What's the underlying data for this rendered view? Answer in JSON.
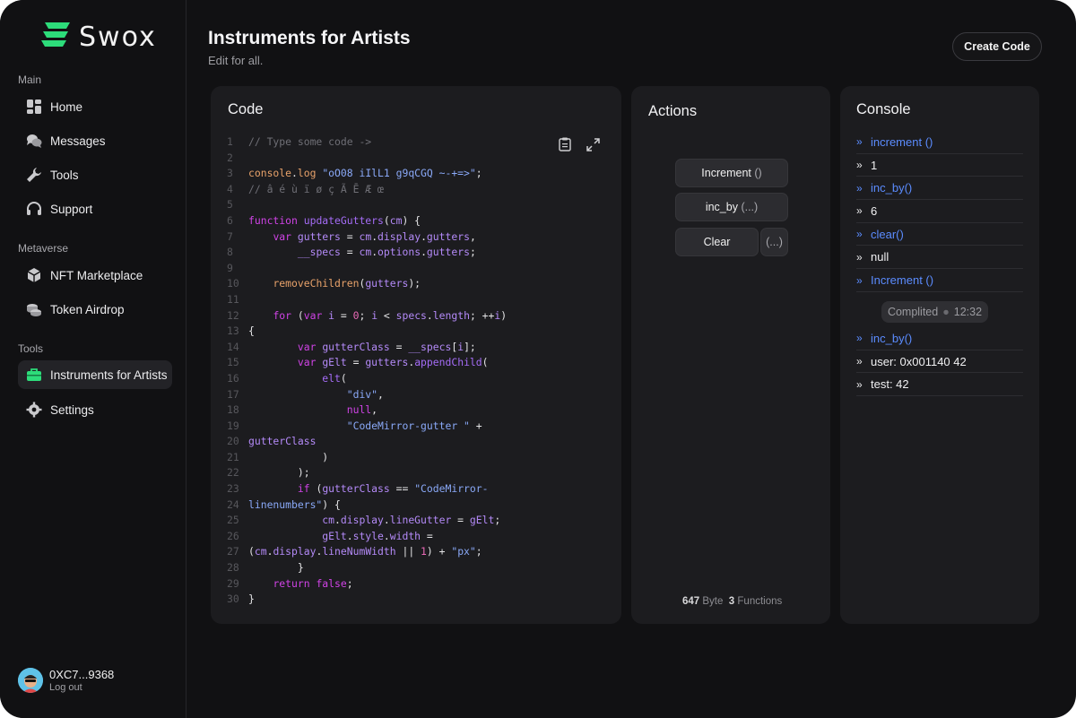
{
  "app": {
    "name": "Swox"
  },
  "sidebar": {
    "sections": [
      {
        "label": "Main"
      },
      {
        "label": "Metaverse"
      },
      {
        "label": "Tools"
      }
    ],
    "items": [
      {
        "label": "Home",
        "icon": "dashboard-grid-icon"
      },
      {
        "label": "Messages",
        "icon": "chat-bubbles-icon"
      },
      {
        "label": "Tools",
        "icon": "wrench-icon"
      },
      {
        "label": "Support",
        "icon": "headset-icon"
      },
      {
        "label": "NFT Marketplace",
        "icon": "hexagon-cube-icon"
      },
      {
        "label": "Token Airdrop",
        "icon": "coins-stack-icon"
      },
      {
        "label": "Instruments for Artists",
        "icon": "toolbox-icon",
        "active": true
      },
      {
        "label": "Settings",
        "icon": "gear-icon"
      }
    ]
  },
  "user": {
    "address": "0XC7...9368",
    "logout": "Log out"
  },
  "header": {
    "title": "Instruments for Artists",
    "subtitle": "Edit for all.",
    "create_button": "Create Code"
  },
  "code_panel": {
    "title": "Code",
    "lines": [
      {
        "n": "1",
        "spans": [
          [
            "cm",
            "// Type some code ->"
          ]
        ]
      },
      {
        "n": "2",
        "spans": []
      },
      {
        "n": "3",
        "spans": [
          [
            "or",
            "console"
          ],
          [
            "",
            "."
          ],
          [
            "or",
            "log"
          ],
          [
            "",
            " "
          ],
          [
            "st",
            "\"oO08 iIlL1 g9qCGQ ~-+=>\""
          ],
          [
            "",
            ";"
          ]
        ]
      },
      {
        "n": "4",
        "spans": [
          [
            "cm",
            "// â é ù ï ø ç Ã Ē Æ œ"
          ]
        ]
      },
      {
        "n": "5",
        "spans": []
      },
      {
        "n": "6",
        "spans": [
          [
            "kw",
            "function"
          ],
          [
            "",
            " "
          ],
          [
            "fn",
            "updateGutters"
          ],
          [
            "",
            "("
          ],
          [
            "vr",
            "cm"
          ],
          [
            "",
            ") {"
          ]
        ]
      },
      {
        "n": "7",
        "spans": [
          [
            "",
            "    "
          ],
          [
            "kw",
            "var"
          ],
          [
            "",
            " "
          ],
          [
            "vr",
            "gutters"
          ],
          [
            "",
            " = "
          ],
          [
            "vr",
            "cm"
          ],
          [
            "",
            "."
          ],
          [
            "vr",
            "display"
          ],
          [
            "",
            "."
          ],
          [
            "vr",
            "gutters"
          ],
          [
            "",
            ","
          ]
        ]
      },
      {
        "n": "8",
        "spans": [
          [
            "",
            "        "
          ],
          [
            "vr",
            "__specs"
          ],
          [
            "",
            " = "
          ],
          [
            "vr",
            "cm"
          ],
          [
            "",
            "."
          ],
          [
            "vr",
            "options"
          ],
          [
            "",
            "."
          ],
          [
            "vr",
            "gutters"
          ],
          [
            "",
            ";"
          ]
        ]
      },
      {
        "n": "9",
        "spans": []
      },
      {
        "n": "10",
        "spans": [
          [
            "",
            "    "
          ],
          [
            "or",
            "removeChildren"
          ],
          [
            "",
            "("
          ],
          [
            "vr",
            "gutters"
          ],
          [
            "",
            ");"
          ]
        ]
      },
      {
        "n": "11",
        "spans": []
      },
      {
        "n": "12",
        "spans": [
          [
            "",
            "    "
          ],
          [
            "kw",
            "for"
          ],
          [
            "",
            " ("
          ],
          [
            "kw",
            "var"
          ],
          [
            "",
            " "
          ],
          [
            "vr",
            "i"
          ],
          [
            "",
            " = "
          ],
          [
            "nm",
            "0"
          ],
          [
            "",
            "; "
          ],
          [
            "vr",
            "i"
          ],
          [
            "",
            " < "
          ],
          [
            "vr",
            "specs"
          ],
          [
            "",
            "."
          ],
          [
            "vr",
            "length"
          ],
          [
            "",
            "; ++"
          ],
          [
            "vr",
            "i"
          ],
          [
            "",
            ")"
          ]
        ]
      },
      {
        "n": "13",
        "spans": [
          [
            "",
            "{"
          ]
        ]
      },
      {
        "n": "14",
        "spans": [
          [
            "",
            "        "
          ],
          [
            "kw",
            "var"
          ],
          [
            "",
            " "
          ],
          [
            "vr",
            "gutterClass"
          ],
          [
            "",
            " = "
          ],
          [
            "vr",
            "__specs"
          ],
          [
            "",
            "["
          ],
          [
            "vr",
            "i"
          ],
          [
            "",
            "];"
          ]
        ]
      },
      {
        "n": "15",
        "spans": [
          [
            "",
            "        "
          ],
          [
            "kw",
            "var"
          ],
          [
            "",
            " "
          ],
          [
            "vr",
            "gElt"
          ],
          [
            "",
            " = "
          ],
          [
            "vr",
            "gutters"
          ],
          [
            "",
            "."
          ],
          [
            "fn",
            "appendChild"
          ],
          [
            "",
            "("
          ]
        ]
      },
      {
        "n": "16",
        "spans": [
          [
            "",
            "            "
          ],
          [
            "fn",
            "elt"
          ],
          [
            "",
            "("
          ]
        ]
      },
      {
        "n": "17",
        "spans": [
          [
            "",
            "                "
          ],
          [
            "st",
            "\"div\""
          ],
          [
            "",
            ","
          ]
        ]
      },
      {
        "n": "18",
        "spans": [
          [
            "",
            "                "
          ],
          [
            "kw",
            "null"
          ],
          [
            "",
            ","
          ]
        ]
      },
      {
        "n": "19",
        "spans": [
          [
            "",
            "                "
          ],
          [
            "st",
            "\"CodeMirror-gutter \""
          ],
          [
            "",
            " +"
          ]
        ]
      },
      {
        "n": "20",
        "spans": [
          [
            "vr",
            "gutterClass"
          ]
        ]
      },
      {
        "n": "21",
        "spans": [
          [
            "",
            "            )"
          ]
        ]
      },
      {
        "n": "22",
        "spans": [
          [
            "",
            "        );"
          ]
        ]
      },
      {
        "n": "23",
        "spans": [
          [
            "",
            "        "
          ],
          [
            "kw",
            "if"
          ],
          [
            "",
            " ("
          ],
          [
            "vr",
            "gutterClass"
          ],
          [
            "",
            " == "
          ],
          [
            "st",
            "\"CodeMirror-"
          ]
        ]
      },
      {
        "n": "24",
        "spans": [
          [
            "st",
            "linenumbers\""
          ],
          [
            "",
            ") {"
          ]
        ]
      },
      {
        "n": "25",
        "spans": [
          [
            "",
            "            "
          ],
          [
            "vr",
            "cm"
          ],
          [
            "",
            "."
          ],
          [
            "vr",
            "display"
          ],
          [
            "",
            "."
          ],
          [
            "vr",
            "lineGutter"
          ],
          [
            "",
            " = "
          ],
          [
            "vr",
            "gElt"
          ],
          [
            "",
            ";"
          ]
        ]
      },
      {
        "n": "26",
        "spans": [
          [
            "",
            "            "
          ],
          [
            "vr",
            "gElt"
          ],
          [
            "",
            "."
          ],
          [
            "vr",
            "style"
          ],
          [
            "",
            "."
          ],
          [
            "vr",
            "width"
          ],
          [
            "",
            " ="
          ]
        ]
      },
      {
        "n": "27",
        "spans": [
          [
            "",
            "("
          ],
          [
            "vr",
            "cm"
          ],
          [
            "",
            "."
          ],
          [
            "vr",
            "display"
          ],
          [
            "",
            "."
          ],
          [
            "vr",
            "lineNumWidth"
          ],
          [
            "",
            " || "
          ],
          [
            "nm",
            "1"
          ],
          [
            "",
            ") + "
          ],
          [
            "st",
            "\"px\""
          ],
          [
            "",
            ";"
          ]
        ]
      },
      {
        "n": "28",
        "spans": [
          [
            "",
            "        }"
          ]
        ]
      },
      {
        "n": "29",
        "spans": [
          [
            "",
            "    "
          ],
          [
            "kw",
            "return"
          ],
          [
            "",
            " "
          ],
          [
            "kw",
            "false"
          ],
          [
            "",
            ";"
          ]
        ]
      },
      {
        "n": "30",
        "spans": [
          [
            "",
            "}"
          ]
        ]
      }
    ],
    "tools": [
      "clipboard-icon",
      "expand-icon"
    ]
  },
  "actions_panel": {
    "title": "Actions",
    "increment": {
      "label": "Increment",
      "args": "()"
    },
    "inc_by": {
      "label": "inc_by",
      "args": "(...)"
    },
    "clear": {
      "label": "Clear",
      "args": "(...)"
    },
    "stats": {
      "bytes": "647",
      "bytes_unit": "Byte",
      "functions": "3",
      "functions_unit": "Functions"
    }
  },
  "console_panel": {
    "title": "Console",
    "rows": [
      {
        "text": "increment ()",
        "kind": "call"
      },
      {
        "text": "1",
        "kind": "result"
      },
      {
        "text": "inc_by()",
        "kind": "call"
      },
      {
        "text": "6",
        "kind": "result"
      },
      {
        "text": "clear()",
        "kind": "call"
      },
      {
        "text": "null",
        "kind": "result"
      },
      {
        "text": "Increment ()",
        "kind": "call"
      }
    ],
    "compiled": {
      "label": "Complited",
      "time": "12:32"
    },
    "rows_after": [
      {
        "text": "inc_by()",
        "kind": "call"
      },
      {
        "text": "user: 0x001140 42",
        "kind": "result"
      },
      {
        "text": "test: 42",
        "kind": "result"
      }
    ]
  },
  "colors": {
    "background": "#111113",
    "panel": "#1c1c1f",
    "accent_green": "#2ddc7a",
    "console_blue": "#5b8cff"
  }
}
